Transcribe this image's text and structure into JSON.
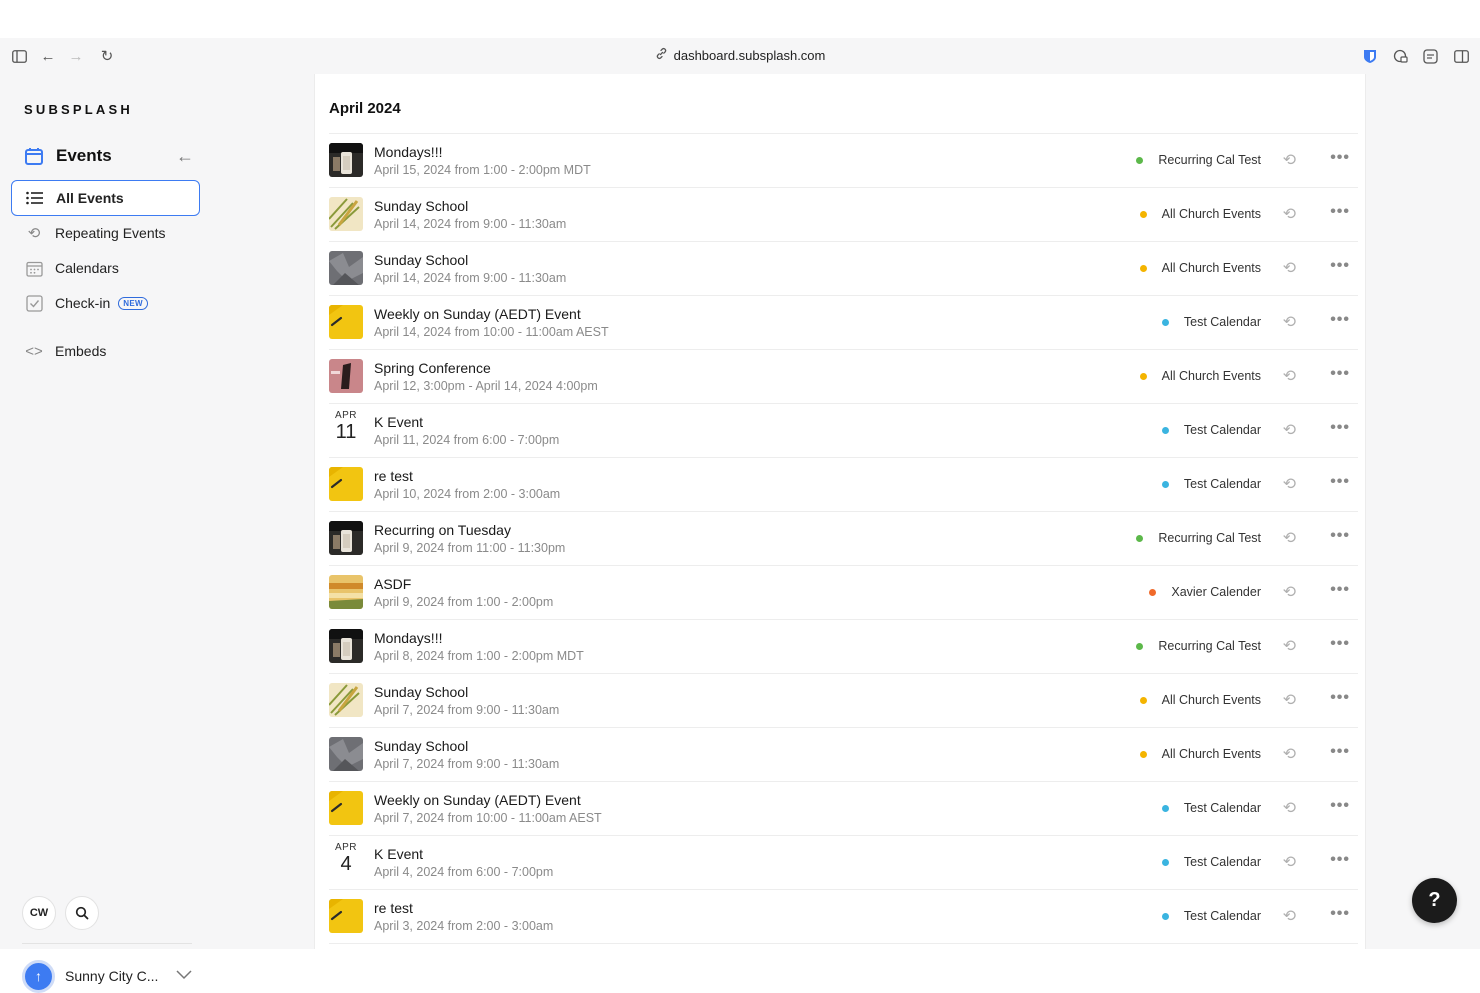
{
  "browser": {
    "url": "dashboard.subsplash.com"
  },
  "sidebar": {
    "logo": "SUBSPLASH",
    "section_title": "Events",
    "items": [
      {
        "label": "All Events",
        "icon": "list-icon",
        "active": true
      },
      {
        "label": "Repeating Events",
        "icon": "repeat-icon",
        "active": false
      },
      {
        "label": "Calendars",
        "icon": "calendar-grid-icon",
        "active": false
      },
      {
        "label": "Check-in",
        "icon": "checkbox-icon",
        "active": false,
        "badge": "NEW"
      },
      {
        "label": "Embeds",
        "icon": "code-icon",
        "active": false
      }
    ],
    "user_initials": "CW",
    "org_name": "Sunny City C..."
  },
  "main": {
    "month_header": "April 2024",
    "events": [
      {
        "title": "Mondays!!!",
        "date": "April 15, 2024 from 1:00 - 2:00pm MDT",
        "calendar": "Recurring Cal Test",
        "dot": "#5cb84a",
        "thumb": "coffee"
      },
      {
        "title": "Sunday School",
        "date": "April 14, 2024 from 9:00 - 11:30am",
        "calendar": "All Church Events",
        "dot": "#f4b400",
        "thumb": "palm"
      },
      {
        "title": "Sunday School",
        "date": "April 14, 2024 from 9:00 - 11:30am",
        "calendar": "All Church Events",
        "dot": "#f4b400",
        "thumb": "gray"
      },
      {
        "title": "Weekly on Sunday (AEDT) Event",
        "date": "April 14, 2024 from 10:00 - 11:00am AEST",
        "calendar": "Test Calendar",
        "dot": "#3ab4e0",
        "thumb": "yellow"
      },
      {
        "title": "Spring Conference",
        "date": "April 12, 3:00pm - April 14, 2024 4:00pm",
        "calendar": "All Church Events",
        "dot": "#f4b400",
        "thumb": "pink"
      },
      {
        "title": "K Event",
        "date": "April 11, 2024 from 6:00 - 7:00pm",
        "calendar": "Test Calendar",
        "dot": "#3ab4e0",
        "thumb": "date",
        "mon": "APR",
        "day": "11"
      },
      {
        "title": "re test",
        "date": "April 10, 2024 from 2:00 - 3:00am",
        "calendar": "Test Calendar",
        "dot": "#3ab4e0",
        "thumb": "yellow"
      },
      {
        "title": "Recurring on Tuesday",
        "date": "April 9, 2024 from 11:00 - 11:30pm",
        "calendar": "Recurring Cal Test",
        "dot": "#5cb84a",
        "thumb": "coffee"
      },
      {
        "title": "ASDF",
        "date": "April 9, 2024 from 1:00 - 2:00pm",
        "calendar": "Xavier Calender",
        "dot": "#f06a2a",
        "thumb": "food"
      },
      {
        "title": "Mondays!!!",
        "date": "April 8, 2024 from 1:00 - 2:00pm MDT",
        "calendar": "Recurring Cal Test",
        "dot": "#5cb84a",
        "thumb": "coffee"
      },
      {
        "title": "Sunday School",
        "date": "April 7, 2024 from 9:00 - 11:30am",
        "calendar": "All Church Events",
        "dot": "#f4b400",
        "thumb": "palm"
      },
      {
        "title": "Sunday School",
        "date": "April 7, 2024 from 9:00 - 11:30am",
        "calendar": "All Church Events",
        "dot": "#f4b400",
        "thumb": "gray"
      },
      {
        "title": "Weekly on Sunday (AEDT) Event",
        "date": "April 7, 2024 from 10:00 - 11:00am AEST",
        "calendar": "Test Calendar",
        "dot": "#3ab4e0",
        "thumb": "yellow"
      },
      {
        "title": "K Event",
        "date": "April 4, 2024 from 6:00 - 7:00pm",
        "calendar": "Test Calendar",
        "dot": "#3ab4e0",
        "thumb": "date",
        "mon": "APR",
        "day": "4"
      },
      {
        "title": "re test",
        "date": "April 3, 2024 from 2:00 - 3:00am",
        "calendar": "Test Calendar",
        "dot": "#3ab4e0",
        "thumb": "yellow"
      }
    ]
  },
  "help_label": "?"
}
